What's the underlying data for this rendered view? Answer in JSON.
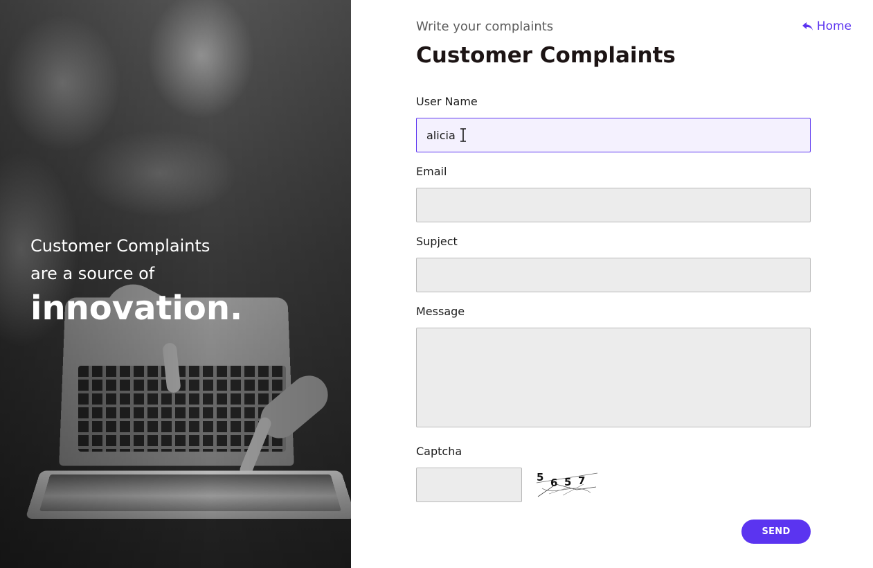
{
  "hero": {
    "line1": "Customer Complaints",
    "line2": "are a source of",
    "line3": "innovation."
  },
  "header": {
    "subtitle": "Write your complaints",
    "title": "Customer Complaints",
    "home_label": "Home",
    "home_icon": "reply-arrow-icon"
  },
  "form": {
    "username": {
      "label": "User Name",
      "value": "alicia"
    },
    "email": {
      "label": "Email",
      "value": ""
    },
    "subject": {
      "label": "Supject",
      "value": ""
    },
    "message": {
      "label": "Message",
      "value": ""
    },
    "captcha": {
      "label": "Captcha",
      "value": "",
      "code": "5657"
    },
    "send_label": "SEND"
  },
  "colors": {
    "accent": "#5b34f0",
    "input_bg": "#ececec",
    "active_input_bg": "#f4f1fe",
    "title": "#1c1414"
  }
}
